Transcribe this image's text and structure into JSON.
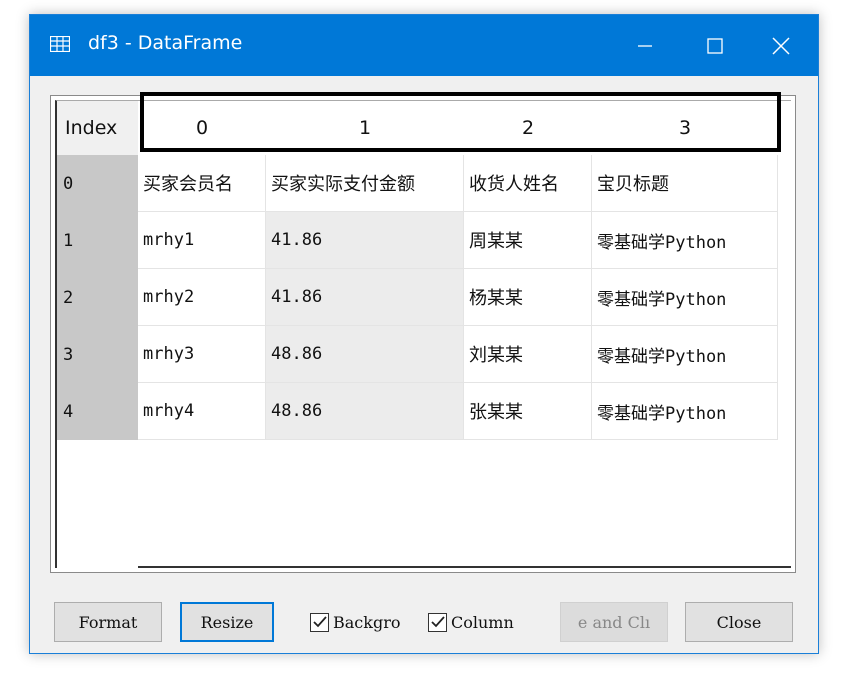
{
  "window": {
    "title": "df3 - DataFrame",
    "minimize_glyph": "—",
    "maximize_glyph": "☐",
    "close_glyph": "✕",
    "titlebar_color": "#0078d7"
  },
  "table": {
    "index_header": "Index",
    "columns": [
      "0",
      "1",
      "2",
      "3"
    ],
    "rows": [
      {
        "index": "0",
        "cells": [
          "买家会员名",
          "买家实际支付金额",
          "收货人姓名",
          "宝贝标题"
        ]
      },
      {
        "index": "1",
        "cells": [
          "mrhy1",
          "41.86",
          "周某某",
          "零基础学Python"
        ]
      },
      {
        "index": "2",
        "cells": [
          "mrhy2",
          "41.86",
          "杨某某",
          "零基础学Python"
        ]
      },
      {
        "index": "3",
        "cells": [
          "mrhy3",
          "48.86",
          "刘某某",
          "零基础学Python"
        ]
      },
      {
        "index": "4",
        "cells": [
          "mrhy4",
          "48.86",
          "张某某",
          "零基础学Python"
        ]
      }
    ]
  },
  "buttons": {
    "format": "Format",
    "resize": "Resize",
    "background_check": "Backgro",
    "column_check": "Column",
    "save_and_close": "e and Clı",
    "close": "Close"
  },
  "checks": {
    "background_checked": true,
    "column_checked": true
  },
  "icons": {
    "app": "table-grid-icon",
    "minimize": "minimize-icon",
    "maximize": "maximize-icon",
    "close": "close-icon"
  }
}
